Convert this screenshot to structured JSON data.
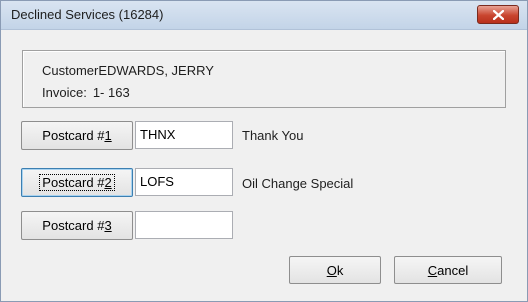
{
  "window": {
    "title": "Declined Services (16284)"
  },
  "info": {
    "customer_label": "Customer",
    "customer_value": "EDWARDS, JERRY",
    "invoice_label": "Invoice:",
    "invoice_value": "1- 163"
  },
  "postcards": [
    {
      "button_text": "Postcard #",
      "button_hotkey": "1",
      "code": "THNX",
      "description": "Thank You",
      "focused": false
    },
    {
      "button_text": "Postcard #",
      "button_hotkey": "2",
      "code": "LOFS",
      "description": "Oil Change Special",
      "focused": true
    },
    {
      "button_text": "Postcard #",
      "button_hotkey": "3",
      "code": "",
      "description": "",
      "focused": false
    }
  ],
  "actions": {
    "ok_hotkey": "O",
    "ok_rest": "k",
    "cancel_hotkey": "C",
    "cancel_rest": "ancel"
  },
  "colors": {
    "close_button": "#c9452f",
    "focus_border": "#3c7fb1"
  }
}
